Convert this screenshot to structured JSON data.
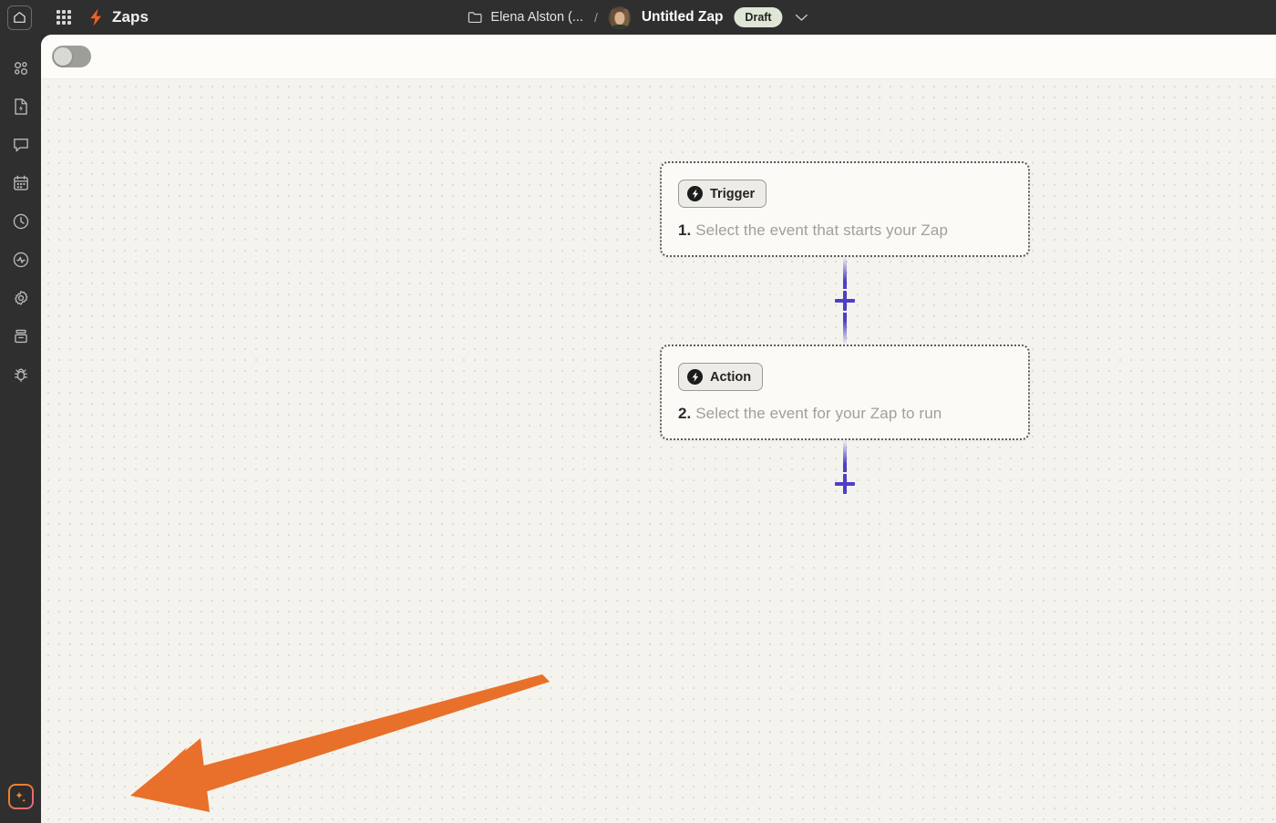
{
  "topbar": {
    "home_icon": "home-icon",
    "apps_icon": "apps-grid-icon",
    "logo_icon": "zapier-bolt-logo",
    "app_title": "Zaps",
    "folder_icon": "folder-icon",
    "folder_name": "Elena Alston (...",
    "separator": "/",
    "avatar_alt": "user-avatar",
    "zap_name": "Untitled Zap",
    "status_badge": "Draft",
    "chevron_icon": "chevron-down-icon",
    "badge_color": "#dfe6d6",
    "bar_color": "#2f2f2f"
  },
  "sidebar": {
    "items": [
      {
        "icon": "zaps-nodes-icon",
        "label": "Zaps"
      },
      {
        "icon": "document-bolt-icon",
        "label": "Interfaces"
      },
      {
        "icon": "chat-bubble-icon",
        "label": "Chatbots"
      },
      {
        "icon": "calendar-icon",
        "label": "Tables"
      },
      {
        "icon": "clock-icon",
        "label": "History"
      },
      {
        "icon": "activity-pulse-icon",
        "label": "Monitoring"
      },
      {
        "icon": "gear-icon",
        "label": "Settings"
      },
      {
        "icon": "storage-box-icon",
        "label": "Storage"
      },
      {
        "icon": "bug-icon",
        "label": "Debug"
      }
    ],
    "ai_button": {
      "icon": "ai-sparkle-icon",
      "label": "AI Assistant"
    }
  },
  "canvas": {
    "toolbar": {
      "toggle": {
        "name": "zap-on-off-toggle",
        "state": "off"
      }
    },
    "background_color": "#f4f3ee",
    "nodes": [
      {
        "badge_icon": "bolt-circle-icon",
        "badge_label": "Trigger",
        "step_number": "1.",
        "description": "Select the event that starts your Zap"
      },
      {
        "badge_icon": "bolt-circle-icon",
        "badge_label": "Action",
        "step_number": "2.",
        "description": "Select the event for your Zap to run"
      }
    ],
    "connectors": [
      {
        "name": "add-step-between-1-2",
        "icon": "plus-icon"
      },
      {
        "name": "add-step-after-2",
        "icon": "plus-icon"
      }
    ],
    "accent_color": "#4f3fc4"
  },
  "annotation": {
    "arrow": {
      "name": "annotation-arrow",
      "color": "#e8702a",
      "points_to": "ai-assistant-button"
    }
  }
}
